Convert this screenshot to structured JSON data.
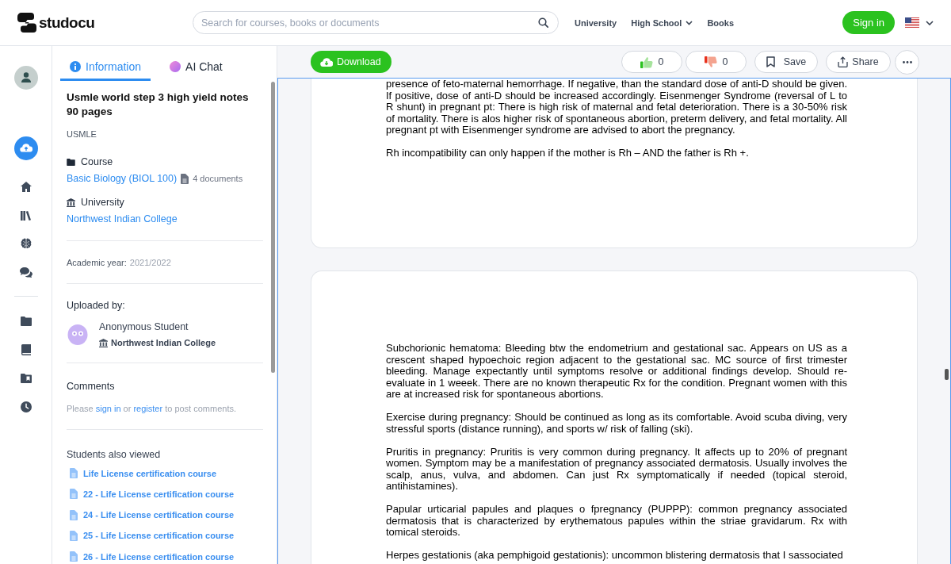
{
  "header": {
    "logo_text": "studocu",
    "search": {
      "placeholder": "Search for courses, books or documents"
    },
    "nav": [
      {
        "label": "University",
        "has_menu": false
      },
      {
        "label": "High School",
        "has_menu": true
      },
      {
        "label": "Books",
        "has_menu": false
      }
    ],
    "sign_in": "Sign in"
  },
  "info_panel": {
    "tabs": [
      {
        "label": "Information",
        "kind": "info",
        "selected": true
      },
      {
        "label": "AI Chat",
        "kind": "ai",
        "selected": false
      }
    ],
    "title": "Usmle world step 3 high yield notes 90 pages",
    "tag": "USMLE",
    "course": {
      "label": "Course",
      "name": "Basic Biology (BIOL 100)",
      "count": "4 documents"
    },
    "university": {
      "label": "University",
      "name": "Northwest Indian College"
    },
    "academic_year": {
      "label": "Academic year:",
      "value": "2021/2022"
    },
    "uploaded_by": {
      "label": "Uploaded by:",
      "name": "Anonymous Student",
      "school": "Northwest Indian College"
    },
    "comments": {
      "heading": "Comments",
      "prompt": [
        {
          "kind": "text",
          "text": "Please"
        },
        {
          "kind": "link",
          "text": "sign in"
        },
        {
          "kind": "text",
          "text": "or"
        },
        {
          "kind": "link",
          "text": "register"
        },
        {
          "kind": "text",
          "text": "to post comments."
        }
      ]
    },
    "also_viewed": {
      "heading": "Students also viewed",
      "items": [
        "Life License certification course",
        "22 - Life License certification course",
        "24 - Life License certification course",
        "25 - Life License certification course",
        "26 - Life License certification course"
      ]
    }
  },
  "toolbar": {
    "download": "Download",
    "likes": "0",
    "dislikes": "0",
    "save": "Save",
    "share": "Share"
  },
  "document": {
    "pages": [
      {
        "paragraphs": [
          "presence of feto-maternal hemorrhage. If negative, than the standard dose of anti-D should be given. If positive, dose of anti-D should be increased accordingly. Eisenmenger Syndrome (reversal of L to R shunt) in pregnant pt: There is high risk of maternal and fetal deterioration. There is a 30-50% risk of mortality. There is alos higher risk of spontaneous abortion, preterm delivery, and fetal mortality. All pregnant pt with Eisenmenger syndrome are advised to abort the pregnancy.",
          "Rh incompatibility can only happen if the mother is Rh – AND the father is Rh +."
        ]
      },
      {
        "paragraphs": [
          "Subchorionic hematoma: Bleeding btw the endometrium and gestational sac. Appears on US as a crescent shaped hypoechoic region adjacent to the gestational sac. MC source of first trimester bleeding. Manage expectantly until symptoms resolve or additional findings develop. Should re-evaluate in 1 weeek. There are no known therapeutic Rx for the condition. Pregnant women with this are at increased risk for spontaneous abortions.",
          "Exercise during pregnancy: Should be continued as long as its comfortable. Avoid scuba diving, very stressful sports (distance running), and sports w/ risk of falling (ski).",
          "Pruritis in pregnancy: Pruritis is very common during pregnancy. It affects up to 20% of pregnant women. Symptom may be a manifestation of pregnancy associated dermatosis. Usually involves the scalp, anus, vulva, and abdomen. Can just Rx symptomatically if needed (topical steroid, antihistamines).",
          "Papular urticarial papules and plaques o fpregnancy (PUPPP): common pregnancy associated dermatosis that is characterized by erythematous papules within the striae gravidarum. Rx with tomical steroids.",
          "Herpes gestationis (aka pemphigoid gestationis): uncommon blistering dermatosis that I sassociated"
        ]
      }
    ]
  }
}
